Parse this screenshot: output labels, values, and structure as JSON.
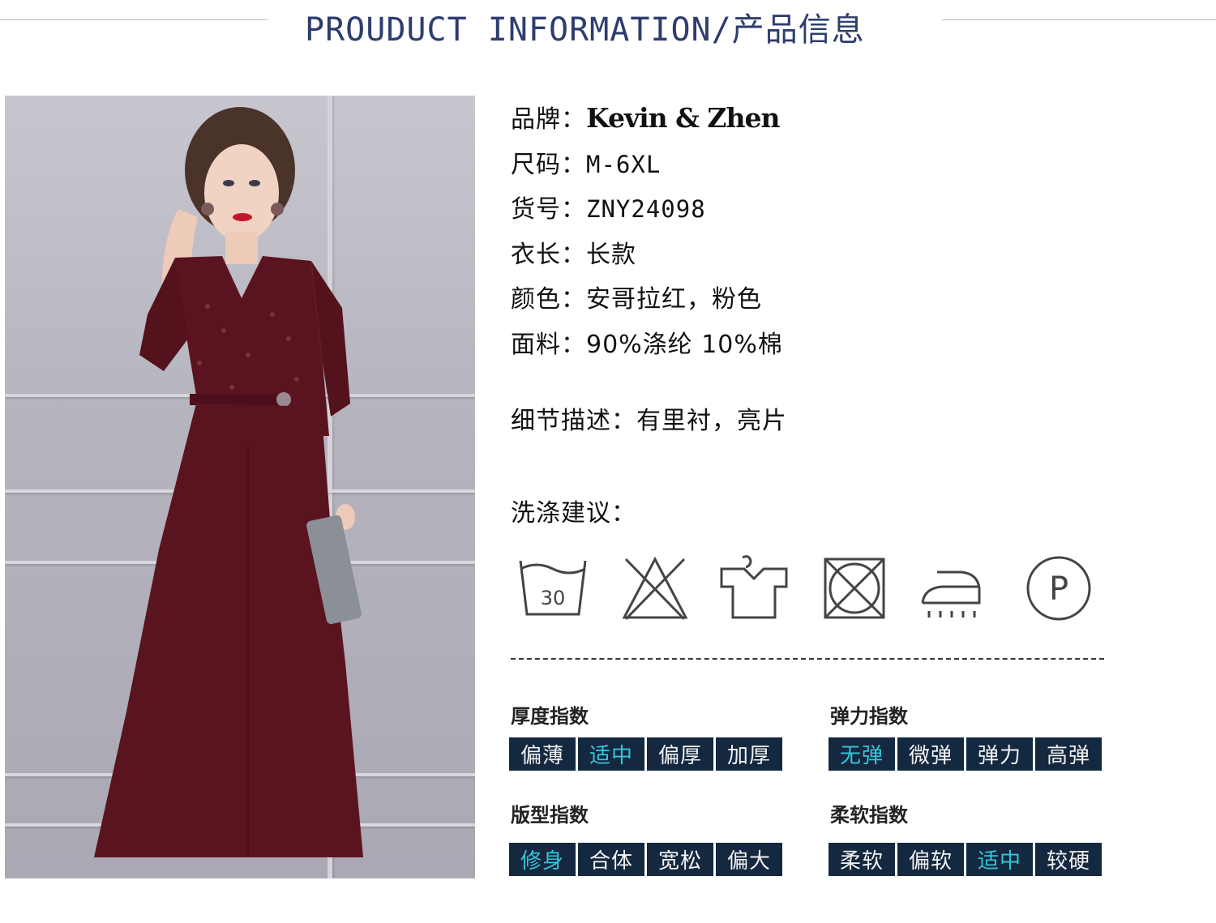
{
  "header": {
    "title": "PROUDUCT INFORMATION/产品信息"
  },
  "info": {
    "brand_label": "品牌：",
    "brand_value": "Kevin & Zhen",
    "size_label": "尺码：",
    "size_value": "M-6XL",
    "item_label": "货号：",
    "item_value": "ZNY24098",
    "length_label": "衣长：",
    "length_value": "长款",
    "color_label": "颜色：",
    "color_value": "安哥拉红，粉色",
    "fabric_label": "面料：",
    "fabric_value": "90%涤纶 10%棉",
    "detail_label": "细节描述：",
    "detail_value": "有里衬，亮片",
    "wash_label": "洗涤建议："
  },
  "care_icons": [
    "wash-30-icon",
    "no-bleach-icon",
    "hang-dry-icon",
    "no-tumble-dry-icon",
    "steam-iron-icon",
    "dry-clean-p-icon"
  ],
  "care_wash_temp": "30",
  "care_dryclean_letter": "P",
  "indices": [
    {
      "title": "厚度指数",
      "options": [
        "偏薄",
        "适中",
        "偏厚",
        "加厚"
      ],
      "selected": "适中"
    },
    {
      "title": "弹力指数",
      "options": [
        "无弹",
        "微弹",
        "弹力",
        "高弹"
      ],
      "selected": "无弹"
    },
    {
      "title": "版型指数",
      "options": [
        "修身",
        "合体",
        "宽松",
        "偏大"
      ],
      "selected": "修身"
    },
    {
      "title": "柔软指数",
      "options": [
        "柔软",
        "偏软",
        "适中",
        "较硬"
      ],
      "selected": "适中"
    }
  ],
  "colors": {
    "header_text": "#2e3d6e",
    "segment_bg": "#142840",
    "segment_active": "#35c6da",
    "dress": "#5a1420"
  }
}
